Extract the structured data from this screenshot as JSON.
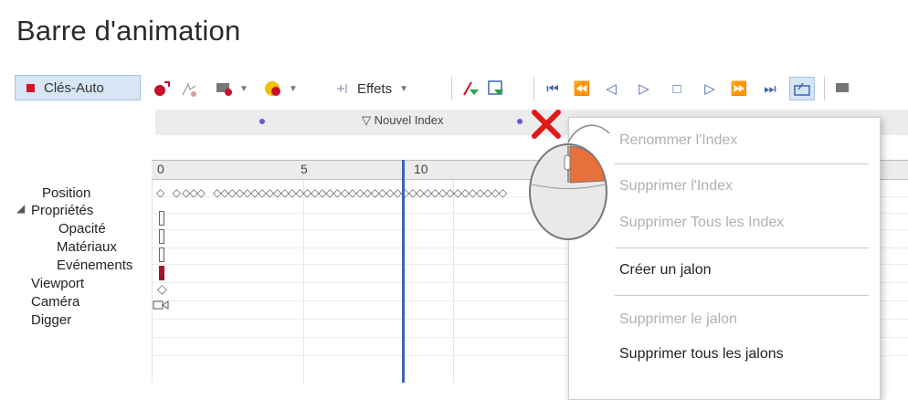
{
  "title": "Barre d'animation",
  "toolbar": {
    "auto_keys": "Clés-Auto",
    "effects": "Effets"
  },
  "index_bar": {
    "new_index": "Nouvel Index"
  },
  "ruler": {
    "ticks": [
      "0",
      "5",
      "10"
    ]
  },
  "tracks": {
    "position": "Position",
    "properties": "Propriétés",
    "opacity": "Opacité",
    "materials": "Matériaux",
    "events": "Evénements",
    "viewport": "Viewport",
    "camera": "Caméra",
    "digger": "Digger"
  },
  "context_menu": {
    "rename_index": "Renommer l'Index",
    "delete_index": "Supprimer l'Index",
    "delete_all_index": "Supprimer Tous les Index",
    "create_milestone": "Créer un jalon",
    "delete_milestone": "Supprimer le jalon",
    "delete_all_milestones": "Supprimer tous les jalons"
  },
  "colors": {
    "accent": "#3d63b0",
    "record": "#d0142a",
    "index_dot": "#6a5acd",
    "events": "#a0162a",
    "mouse_button": "#e8703a"
  }
}
